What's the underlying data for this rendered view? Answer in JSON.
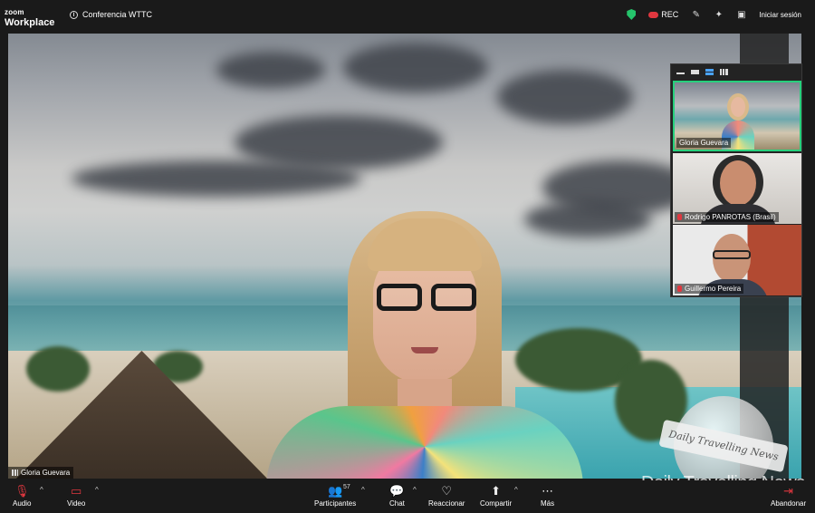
{
  "app": {
    "logo_line1": "zoom",
    "logo_line2": "Workplace"
  },
  "meeting": {
    "title": "Conferencia WTTC"
  },
  "topbar": {
    "rec_label": "REC",
    "sign_in": "Iniciar sesión"
  },
  "stage": {
    "speaker_name": "Gloria Guevara"
  },
  "gallery": {
    "tiles": [
      {
        "name": "Gloria Guevara"
      },
      {
        "name": "Rodrigo PANROTAS (Brasil)"
      },
      {
        "name": "Guillermo Pereira"
      }
    ]
  },
  "toolbar": {
    "audio": "Audio",
    "video": "Video",
    "participants": "Participantes",
    "participants_count": "57",
    "chat": "Chat",
    "react": "Reaccionar",
    "share": "Compartir",
    "more": "Más",
    "leave": "Abandonar"
  },
  "watermark": {
    "text": "Daily Travelling News",
    "banner": "Daily Travelling News"
  },
  "colors": {
    "accent_green": "#26d07c",
    "rec_red": "#e0373f",
    "active_blue": "#4aa3ff"
  }
}
